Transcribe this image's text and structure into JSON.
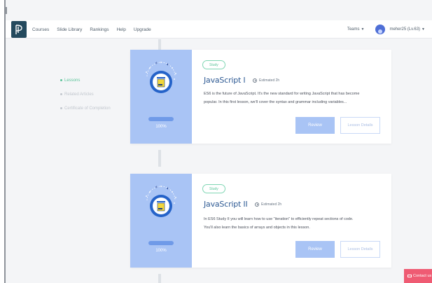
{
  "nav": {
    "links": [
      "Courses",
      "Slide Library",
      "Rankings",
      "Help",
      "Upgrade"
    ],
    "teams_label": "Teams",
    "user_label": "meher25 (Lv.63)"
  },
  "side_menu": {
    "items": [
      "Lessons",
      "Related Articles",
      "Certificate of Completion"
    ]
  },
  "lessons": [
    {
      "tag": "Study",
      "title": "JavaScript I",
      "estimate": "Estimated 2h",
      "description_line1": "ES6 is the future of JavaScript. It's the new standard for writing JavaScript that has become",
      "description_line2": "popular. In this first lesson, we'll cover the syntax and grammar including variables...",
      "progress_label": "100%",
      "progress": 1.0,
      "review_label": "Review",
      "details_label": "Lesson Details"
    },
    {
      "tag": "Study",
      "title": "JavaScript II",
      "estimate": "Estimated 2h",
      "description_line1": "In ES6 Study II you will learn how to use \"iteration\" to efficiently repeat sections of code.",
      "description_line2": "You'll also learn the basics of arrays and objects in this lesson.",
      "progress_label": "100%",
      "progress": 1.0,
      "review_label": "Review",
      "details_label": "Lesson Details"
    }
  ],
  "contact_label": "Contact us",
  "colors": {
    "accent_blue": "#a9c4f5",
    "title_blue": "#2f5b94",
    "green": "#5cc49a",
    "contact_red": "#ef5b73"
  },
  "icons": [
    "logo-icon",
    "chevron-down-icon",
    "avatar-icon",
    "clock-icon",
    "lesson-badge-icon",
    "mail-icon"
  ]
}
